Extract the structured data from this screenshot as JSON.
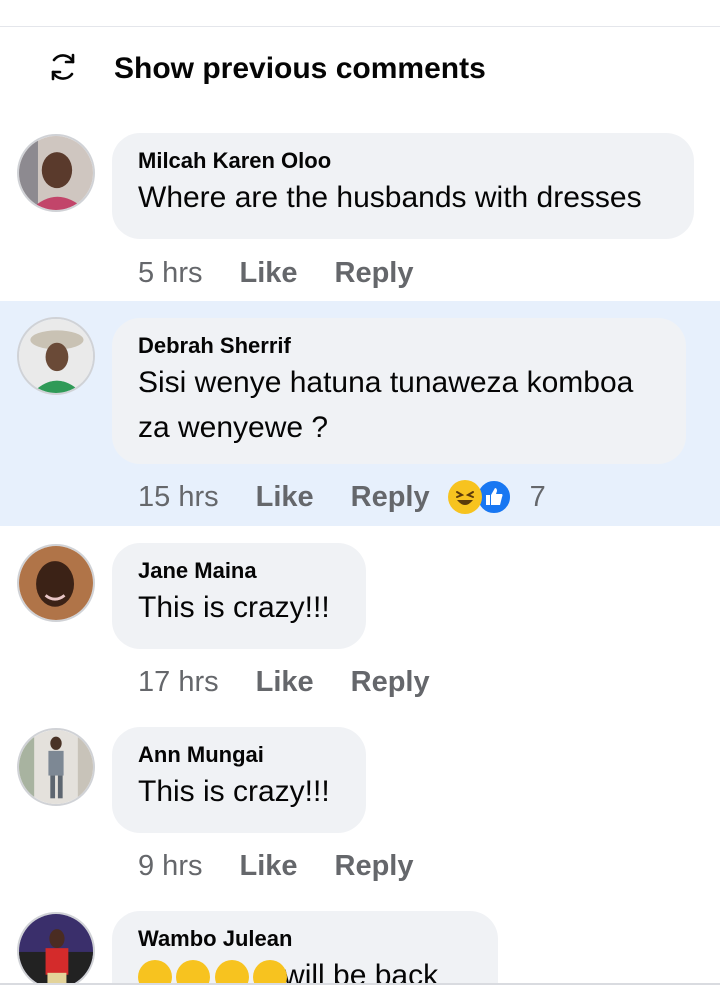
{
  "show_previous": {
    "label": "Show previous comments",
    "icon": "refresh-icon"
  },
  "comments": [
    {
      "name": "Milcah Karen Oloo",
      "text": "Where are the husbands with dresses",
      "time": "5 hrs",
      "like": "Like",
      "reply": "Reply"
    },
    {
      "name": "Debrah Sherrif",
      "text_line1": "Sisi wenye hatuna tunaweza komboa",
      "text_line2": "za wenyewe ?",
      "time": "15 hrs",
      "like": "Like",
      "reply": "Reply",
      "reaction_count": "7",
      "reactions": [
        "laughing-emoji",
        "like-thumb"
      ]
    },
    {
      "name": "Jane Maina",
      "text": "This is crazy!!!",
      "time": "17 hrs",
      "like": "Like",
      "reply": "Reply"
    },
    {
      "name": "Ann Mungai",
      "text": "This is crazy!!!",
      "time": "9 hrs",
      "like": "Like",
      "reply": "Reply"
    },
    {
      "name": "Wambo Julean",
      "text_emojis": [
        "rolling-laughing-emoji",
        "rolling-laughing-emoji",
        "laughing-tears-emoji",
        "laughing-tears-emoji"
      ],
      "text": "will be back"
    }
  ],
  "colors": {
    "highlight_bg": "#e7f0fc",
    "bubble_bg": "#f0f2f5",
    "meta_text": "#65676b",
    "like_blue": "#1877f2",
    "emoji_yellow": "#f7c31f"
  }
}
